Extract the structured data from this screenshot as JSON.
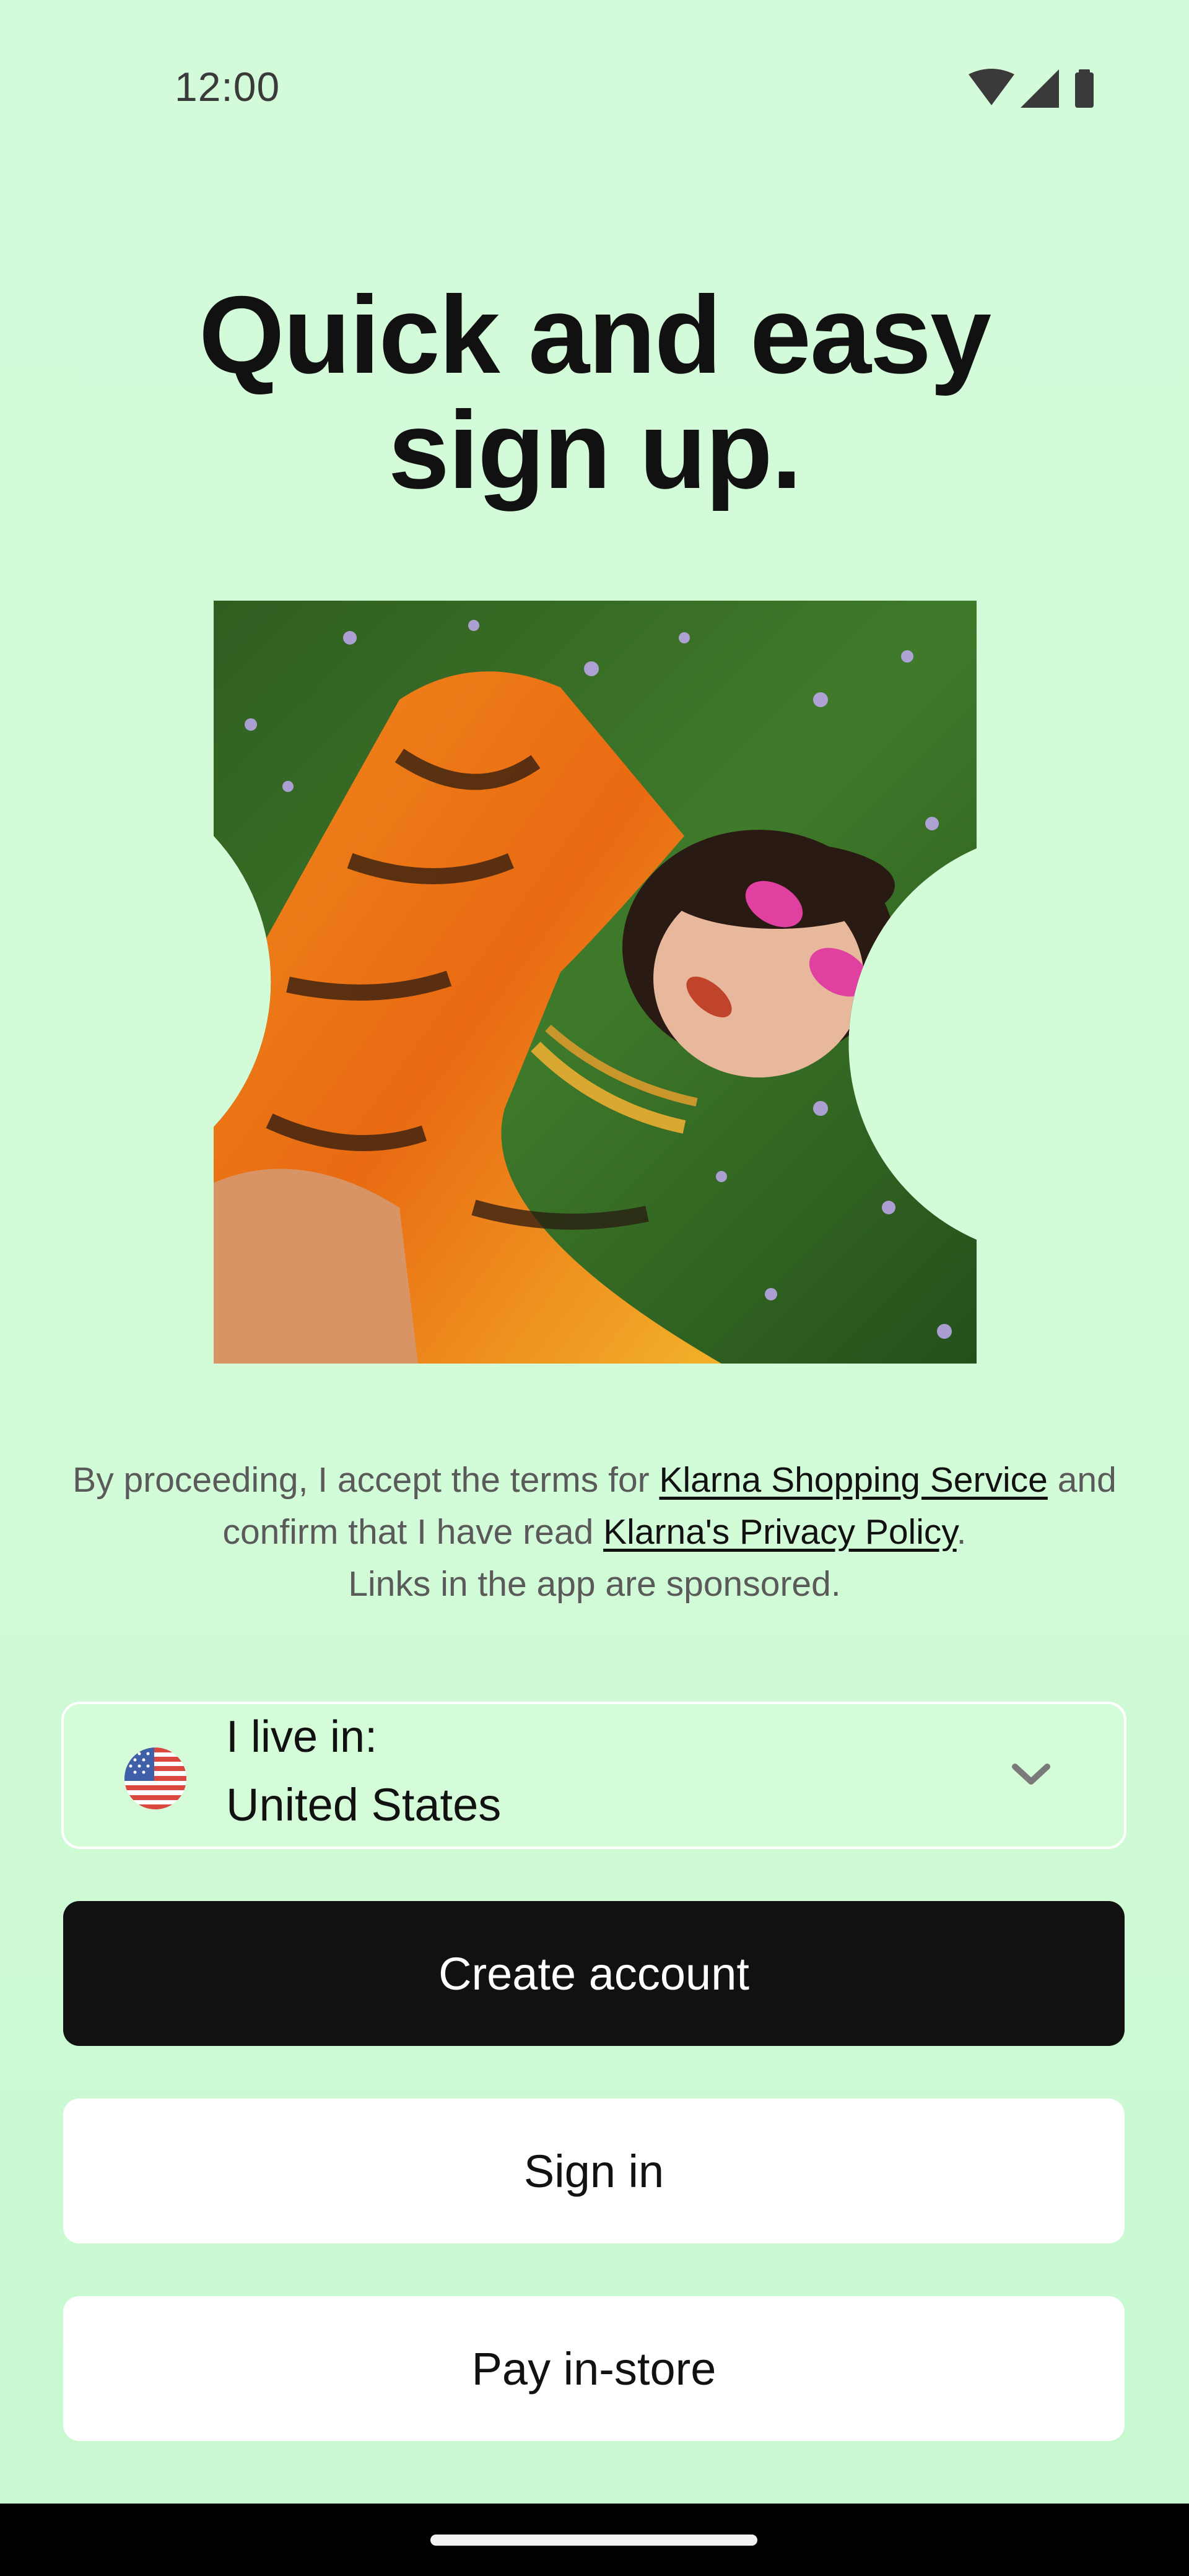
{
  "status_bar": {
    "time": "12:00",
    "icons": [
      "wifi-icon",
      "signal-icon",
      "battery-icon"
    ]
  },
  "headline": {
    "line1": "Quick and easy",
    "line2": "sign up."
  },
  "hero_image": {
    "description_icon": "photo"
  },
  "legal": {
    "part1": "By proceeding, I accept the terms for ",
    "link1": "Klarna Shopping Service",
    "part2": " and confirm that I have read ",
    "link2": "Klarna's Privacy Policy",
    "part3": ".",
    "sponsored": "Links in the app are sponsored."
  },
  "country_select": {
    "label": "I live in:",
    "value": "United States",
    "flag_icon": "us-flag-icon",
    "chevron_icon": "chevron-down-icon"
  },
  "buttons": {
    "create_account": "Create account",
    "sign_in": "Sign in",
    "pay_in_store": "Pay in-store"
  },
  "colors": {
    "background": "#d4fbd9",
    "primary_button": "#111111",
    "secondary_button": "#ffffff"
  }
}
